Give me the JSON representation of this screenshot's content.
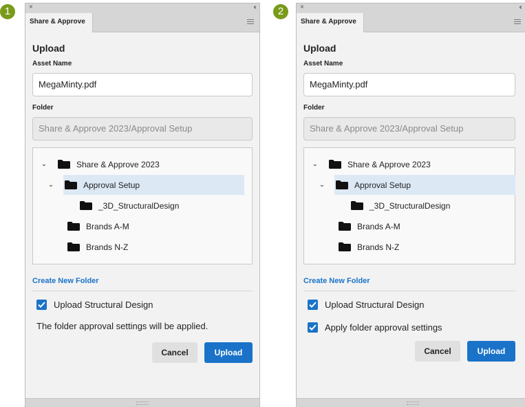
{
  "panels": [
    {
      "badge": "1",
      "close": "×",
      "collapse": "‹‹",
      "tab": "Share & Approve",
      "heading": "Upload",
      "asset_name_label": "Asset Name",
      "asset_name_value": "MegaMinty.pdf",
      "folder_label": "Folder",
      "folder_value": "Share & Approve 2023/Approval Setup",
      "tree": [
        {
          "label": "Share & Approve 2023",
          "chevron": "⌄"
        },
        {
          "label": "Approval Setup",
          "chevron": "⌄",
          "selected": true
        },
        {
          "label": "_3D_StructuralDesign",
          "chevron": ""
        },
        {
          "label": "Brands A-M",
          "chevron": ""
        },
        {
          "label": "Brands N-Z",
          "chevron": ""
        }
      ],
      "create_folder": "Create New Folder",
      "checkbox_upload_structural": "Upload Structural Design",
      "note": "The folder approval settings will be applied.",
      "cancel": "Cancel",
      "upload": "Upload"
    },
    {
      "badge": "2",
      "close": "×",
      "collapse": "‹‹",
      "tab": "Share & Approve",
      "heading": "Upload",
      "asset_name_label": "Asset Name",
      "asset_name_value": "MegaMinty.pdf",
      "folder_label": "Folder",
      "folder_value": "Share & Approve 2023/Approval Setup",
      "tree": [
        {
          "label": "Share & Approve 2023",
          "chevron": "⌄"
        },
        {
          "label": "Approval Setup",
          "chevron": "⌄",
          "selected": true
        },
        {
          "label": "_3D_StructuralDesign",
          "chevron": ""
        },
        {
          "label": "Brands A-M",
          "chevron": ""
        },
        {
          "label": "Brands N-Z",
          "chevron": ""
        }
      ],
      "create_folder": "Create New Folder",
      "checkbox_upload_structural": "Upload Structural Design",
      "checkbox_apply_folder": "Apply folder approval settings",
      "cancel": "Cancel",
      "upload": "Upload"
    }
  ],
  "colors": {
    "accent": "#1a73c8",
    "badge": "#7a9a1a",
    "selected_row": "#dde8f5"
  },
  "icons": [
    "close-icon",
    "collapse-icon",
    "menu-icon",
    "chevron-down-icon",
    "folder-icon",
    "checkmark-icon",
    "resize-grip-icon"
  ]
}
